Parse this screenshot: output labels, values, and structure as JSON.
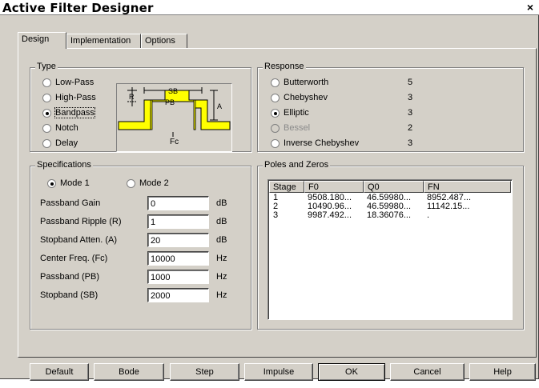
{
  "window": {
    "title": "Active Filter Designer",
    "close_glyph": "×"
  },
  "tabs": [
    {
      "label": "Design",
      "active": true
    },
    {
      "label": "Implementation",
      "active": false
    },
    {
      "label": "Options",
      "active": false
    }
  ],
  "type_group": {
    "label": "Type",
    "options": [
      "Low-Pass",
      "High-Pass",
      "Bandpass",
      "Notch",
      "Delay"
    ],
    "selected": "Bandpass",
    "diagram": {
      "sb": "SB",
      "pb": "PB",
      "r": "R",
      "a": "A",
      "fc": "Fc",
      "fill_color": "#ffff00"
    }
  },
  "response_group": {
    "label": "Response",
    "options": [
      {
        "label": "Butterworth",
        "order": "5",
        "enabled": true
      },
      {
        "label": "Chebyshev",
        "order": "3",
        "enabled": true
      },
      {
        "label": "Elliptic",
        "order": "3",
        "enabled": true
      },
      {
        "label": "Bessel",
        "order": "2",
        "enabled": false
      },
      {
        "label": "Inverse Chebyshev",
        "order": "3",
        "enabled": true
      }
    ],
    "selected": "Elliptic"
  },
  "specs_group": {
    "label": "Specifications",
    "mode1": "Mode 1",
    "mode2": "Mode 2",
    "selected_mode": "Mode 1",
    "rows": [
      {
        "label": "Passband Gain",
        "value": "0",
        "unit": "dB"
      },
      {
        "label": "Passband Ripple (R)",
        "value": "1",
        "unit": "dB"
      },
      {
        "label": "Stopband Atten. (A)",
        "value": "20",
        "unit": "dB"
      },
      {
        "label": "Center Freq. (Fc)",
        "value": "10000",
        "unit": "Hz"
      },
      {
        "label": "Passband (PB)",
        "value": "1000",
        "unit": "Hz"
      },
      {
        "label": "Stopband (SB)",
        "value": "2000",
        "unit": "Hz"
      }
    ]
  },
  "poles_group": {
    "label": "Poles and Zeros",
    "columns": [
      "Stage",
      "F0",
      "Q0",
      "FN"
    ],
    "rows": [
      [
        "1",
        "9508.180...",
        "46.59980...",
        "8952.487..."
      ],
      [
        "2",
        "10490.96...",
        "46.59980...",
        "11142.15..."
      ],
      [
        "3",
        "9987.492...",
        "18.36076...",
        "."
      ]
    ]
  },
  "buttons": [
    "Default",
    "Bode",
    "Step",
    "Impulse",
    "OK",
    "Cancel",
    "Help"
  ]
}
